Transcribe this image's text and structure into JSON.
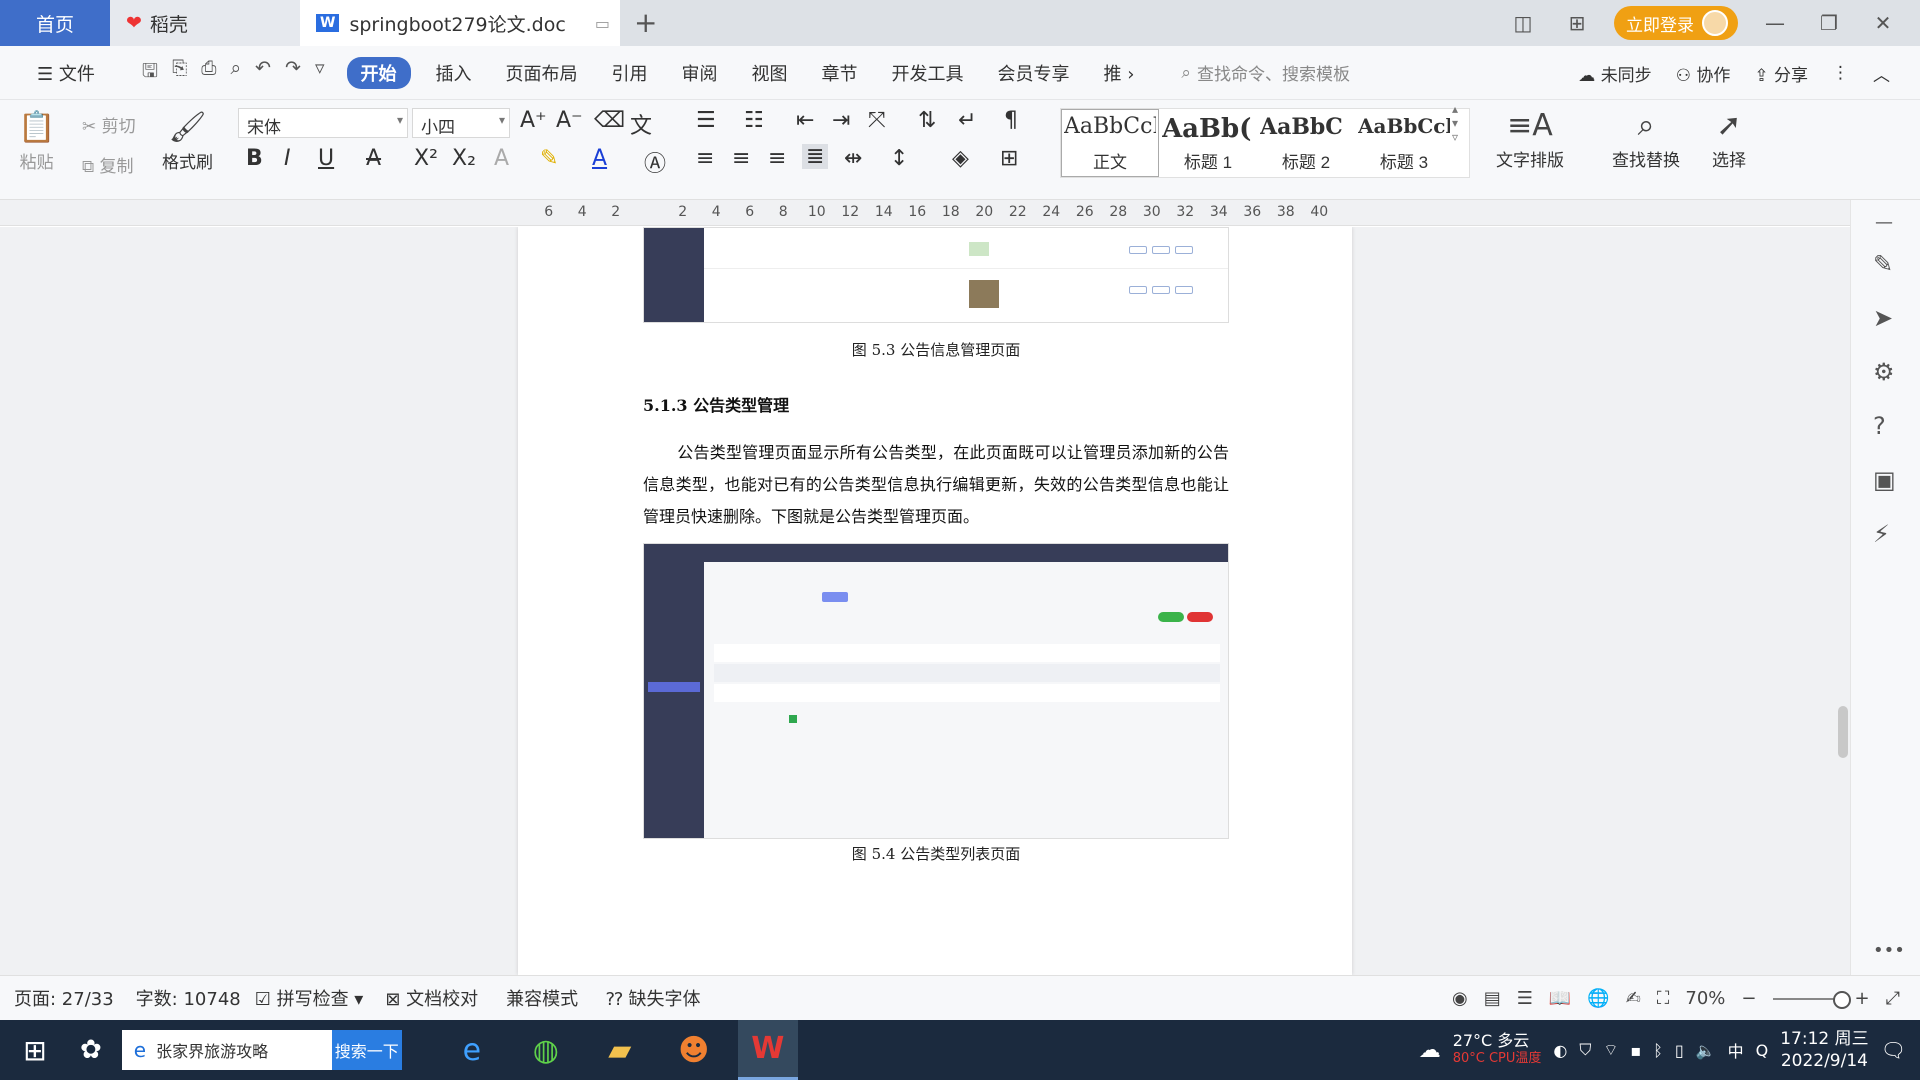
{
  "tabs": {
    "home": "首页",
    "daoke": "稻壳",
    "doc": "springboot279论文.doc",
    "login": "立即登录"
  },
  "menu": {
    "file": "文件",
    "items": [
      "开始",
      "插入",
      "页面布局",
      "引用",
      "审阅",
      "视图",
      "章节",
      "开发工具",
      "会员专享",
      "推"
    ],
    "search": "查找命令、搜索模板",
    "sync": "未同步",
    "collab": "协作",
    "share": "分享"
  },
  "ribbon": {
    "paste": "粘贴",
    "cut": "剪切",
    "copy": "复制",
    "format_painter": "格式刷",
    "font": "宋体",
    "size": "小四",
    "styles": [
      {
        "sample": "AaBbCcI",
        "label": "正文"
      },
      {
        "sample": "AaBb(",
        "label": "标题 1"
      },
      {
        "sample": "AaBbC",
        "label": "标题 2"
      },
      {
        "sample": "AaBbCcl",
        "label": "标题 3"
      }
    ],
    "text_layout": "文字排版",
    "find_replace": "查找替换",
    "select": "选择"
  },
  "ruler": [
    "6",
    "4",
    "2",
    "",
    "2",
    "4",
    "6",
    "8",
    "10",
    "12",
    "14",
    "16",
    "18",
    "20",
    "22",
    "24",
    "26",
    "28",
    "30",
    "32",
    "34",
    "36",
    "38",
    "40"
  ],
  "document": {
    "caption1": "图 5.3  公告信息管理页面",
    "heading": "5.1.3  公告类型管理",
    "paragraph": "公告类型管理页面显示所有公告类型，在此页面既可以让管理员添加新的公告信息类型，也能对已有的公告类型信息执行编辑更新，失效的公告类型信息也能让管理员快速删除。下图就是公告类型管理页面。",
    "caption2": "图 5.4  公告类型列表页面"
  },
  "status": {
    "page": "页面: 27/33",
    "words": "字数: 10748",
    "spell": "拼写检查",
    "proof": "文档校对",
    "compat": "兼容模式",
    "missing_font": "缺失字体",
    "zoom": "70%"
  },
  "taskbar": {
    "search_text": "张家界旅游攻略",
    "search_btn": "搜索一下",
    "weather": "27°C 多云",
    "cpu": "80°C CPU温度",
    "ime": "中",
    "time": "17:12 周三",
    "date": "2022/9/14"
  },
  "colors": {
    "accent": "#3f6ec9",
    "login": "#f0a013",
    "taskbar": "#1b2a3e"
  }
}
